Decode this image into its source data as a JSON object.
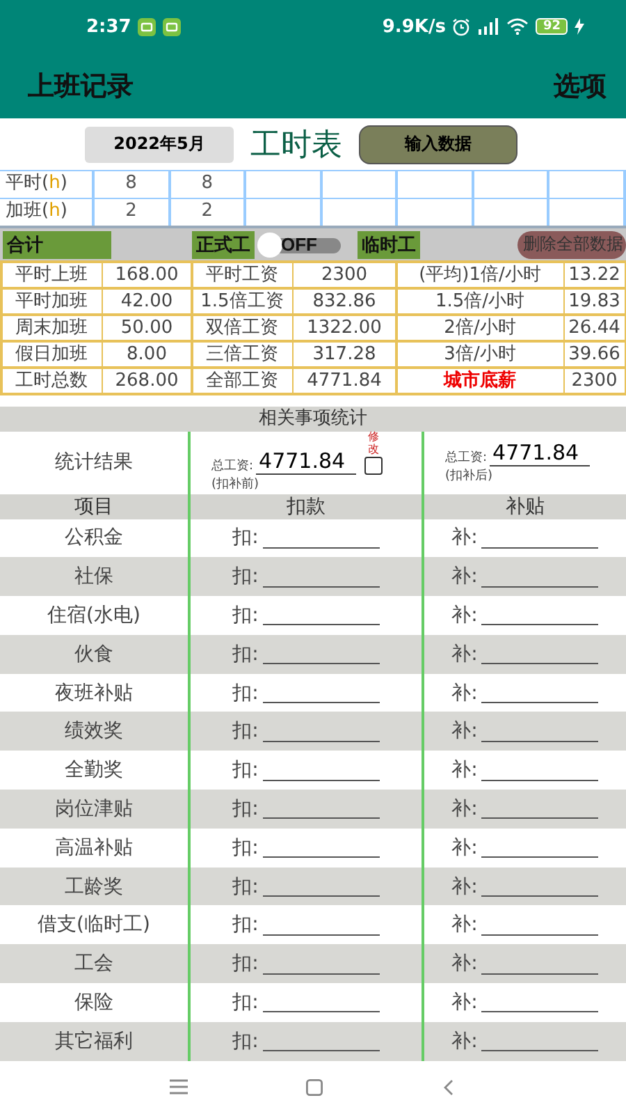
{
  "status_bar": {
    "time": "2:37",
    "speed": "9.9K/s",
    "battery": "92"
  },
  "app_bar": {
    "title": "上班记录",
    "menu": "选项"
  },
  "toolbar": {
    "month": "2022年5月",
    "title": "工时表",
    "button": "输入数据"
  },
  "hours": [
    {
      "label": "平时(",
      "unit": "h",
      "label_end": ")",
      "values": [
        "8",
        "8"
      ]
    },
    {
      "label": "加班(",
      "unit": "h",
      "label_end": ")",
      "values": [
        "2",
        "2"
      ]
    }
  ],
  "summary_bar": {
    "total": "合计",
    "regular": "正式工",
    "toggle": {
      "label": "OFF",
      "on": false
    },
    "temporary": "临时工",
    "delete_button": "删除全部数据"
  },
  "wage_table": [
    [
      {
        "text": "平时上班",
        "emphasis": false
      },
      {
        "text": "168.00",
        "emphasis": false
      },
      {
        "text": "平时工资",
        "emphasis": false
      },
      {
        "text": "2300",
        "emphasis": false
      },
      {
        "text": "(平均)1倍/小时",
        "emphasis": false
      },
      {
        "text": "13.22",
        "emphasis": false
      }
    ],
    [
      {
        "text": "平时加班",
        "emphasis": false
      },
      {
        "text": "42.00",
        "emphasis": false
      },
      {
        "text": "1.5倍工资",
        "emphasis": false
      },
      {
        "text": "832.86",
        "emphasis": false
      },
      {
        "text": "1.5倍/小时",
        "emphasis": false
      },
      {
        "text": "19.83",
        "emphasis": false
      }
    ],
    [
      {
        "text": "周末加班",
        "emphasis": false
      },
      {
        "text": "50.00",
        "emphasis": false
      },
      {
        "text": "双倍工资",
        "emphasis": false
      },
      {
        "text": "1322.00",
        "emphasis": false
      },
      {
        "text": "2倍/小时",
        "emphasis": false
      },
      {
        "text": "26.44",
        "emphasis": false
      }
    ],
    [
      {
        "text": "假日加班",
        "emphasis": false
      },
      {
        "text": "8.00",
        "emphasis": false
      },
      {
        "text": "三倍工资",
        "emphasis": false
      },
      {
        "text": "317.28",
        "emphasis": false
      },
      {
        "text": "3倍/小时",
        "emphasis": false
      },
      {
        "text": "39.66",
        "emphasis": false
      }
    ],
    [
      {
        "text": "工时总数",
        "emphasis": false
      },
      {
        "text": "268.00",
        "emphasis": false
      },
      {
        "text": "全部工资",
        "emphasis": false
      },
      {
        "text": "4771.84",
        "emphasis": false
      },
      {
        "text": "城市底薪",
        "emphasis": true
      },
      {
        "text": "2300",
        "emphasis": false
      }
    ]
  ],
  "stats": {
    "title": "相关事项统计",
    "result_label": "统计结果",
    "before": {
      "label": "总工资:",
      "value": "4771.84",
      "note": "(扣补前)"
    },
    "edit": {
      "label": "修改",
      "checked": false
    },
    "after": {
      "label": "总工资:",
      "value": "4771.84",
      "note": "(扣补后)"
    },
    "headers": [
      "项目",
      "扣款",
      "补贴"
    ],
    "items": [
      {
        "name": "公积金",
        "deduct": "扣:",
        "subsidy": "补:"
      },
      {
        "name": "社保",
        "deduct": "扣:",
        "subsidy": "补:"
      },
      {
        "name": "住宿(水电)",
        "deduct": "扣:",
        "subsidy": "补:"
      },
      {
        "name": "伙食",
        "deduct": "扣:",
        "subsidy": "补:"
      },
      {
        "name": "夜班补贴",
        "deduct": "扣:",
        "subsidy": "补:"
      },
      {
        "name": "绩效奖",
        "deduct": "扣:",
        "subsidy": "补:"
      },
      {
        "name": "全勤奖",
        "deduct": "扣:",
        "subsidy": "补:"
      },
      {
        "name": "岗位津贴",
        "deduct": "扣:",
        "subsidy": "补:"
      },
      {
        "name": "高温补贴",
        "deduct": "扣:",
        "subsidy": "补:"
      },
      {
        "name": "工龄奖",
        "deduct": "扣:",
        "subsidy": "补:"
      },
      {
        "name": "借支(临时工)",
        "deduct": "扣:",
        "subsidy": "补:"
      },
      {
        "name": "工会",
        "deduct": "扣:",
        "subsidy": "补:"
      },
      {
        "name": "保险",
        "deduct": "扣:",
        "subsidy": "补:"
      },
      {
        "name": "其它福利",
        "deduct": "扣:",
        "subsidy": "补:"
      }
    ]
  }
}
